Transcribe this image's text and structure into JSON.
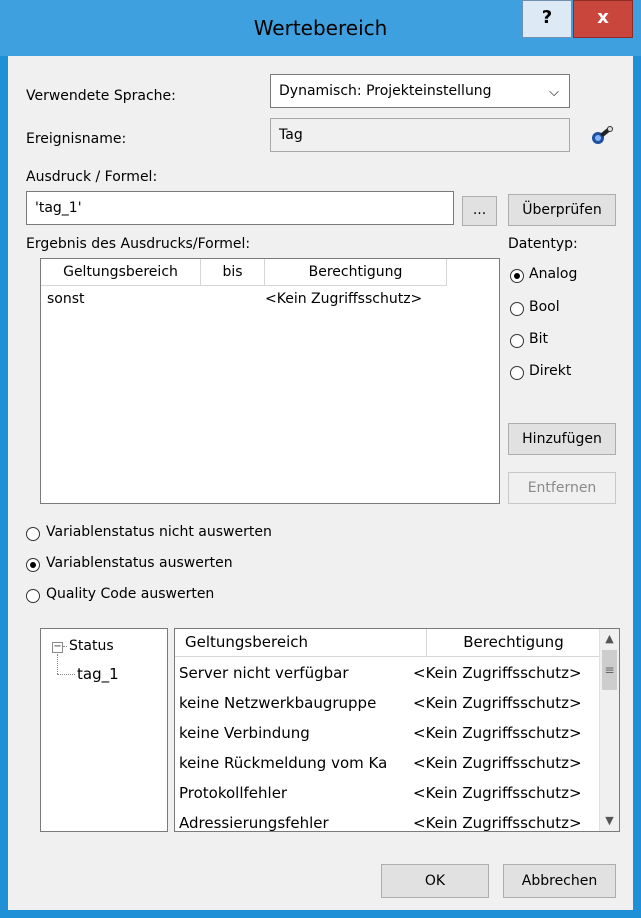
{
  "window": {
    "title": "Wertebereich",
    "help_label": "?",
    "close_label": "x"
  },
  "language": {
    "label": "Verwendete Sprache:",
    "value": "Dynamisch: Projekteinstellung"
  },
  "event": {
    "label": "Ereignisname:",
    "value": "Tag",
    "icon": "tag-picker-icon"
  },
  "expression": {
    "label": "Ausdruck / Formel:",
    "value": "'tag_1'",
    "browse_label": "...",
    "check_label": "Überprüfen"
  },
  "result": {
    "label": "Ergebnis des Ausdrucks/Formel:",
    "columns": [
      "Geltungsbereich",
      "bis",
      "Berechtigung"
    ],
    "rows": [
      {
        "range": "sonst",
        "to": "",
        "permission": "<Kein Zugriffsschutz>"
      }
    ]
  },
  "datatype": {
    "label": "Datentyp:",
    "options": [
      "Analog",
      "Bool",
      "Bit",
      "Direkt"
    ],
    "selected": "Analog"
  },
  "actions": {
    "add_label": "Hinzufügen",
    "remove_label": "Entfernen"
  },
  "status_mode": {
    "options": [
      "Variablenstatus nicht auswerten",
      "Variablenstatus auswerten",
      "Quality Code auswerten"
    ],
    "selected": "Variablenstatus auswerten"
  },
  "tree": {
    "root": "Status",
    "expander": "−",
    "child": "tag_1"
  },
  "status_grid": {
    "columns": [
      "Geltungsbereich",
      "Berechtigung"
    ],
    "rows": [
      {
        "range": "Server nicht verfügbar",
        "permission": "<Kein Zugriffsschutz>"
      },
      {
        "range": "keine Netzwerkbaugruppe",
        "permission": "<Kein Zugriffsschutz>"
      },
      {
        "range": "keine Verbindung",
        "permission": "<Kein Zugriffsschutz>"
      },
      {
        "range": "keine Rückmeldung vom Ka",
        "permission": "<Kein Zugriffsschutz>"
      },
      {
        "range": "Protokollfehler",
        "permission": "<Kein Zugriffsschutz>"
      },
      {
        "range": "Adressierungsfehler",
        "permission": "<Kein Zugriffsschutz>"
      }
    ]
  },
  "footer": {
    "ok_label": "OK",
    "cancel_label": "Abbrechen"
  },
  "colors": {
    "title_bar": "#3fa0df",
    "close_button": "#c9463d",
    "dialog_bg": "#f0f0f0"
  }
}
